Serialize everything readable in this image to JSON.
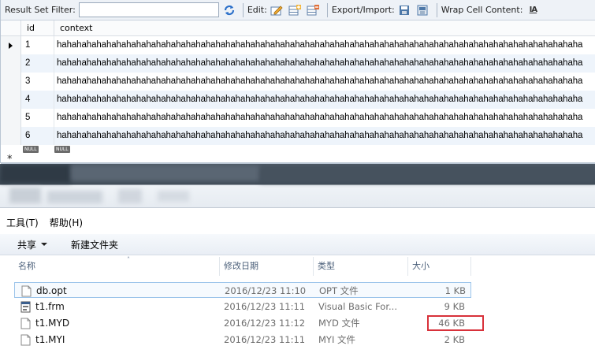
{
  "workbench": {
    "toolbar": {
      "filter_label": "Result Set Filter:",
      "filter_value": "",
      "edit_label": "Edit:",
      "export_label": "Export/Import:",
      "wrap_label": "Wrap Cell Content:",
      "wrap_icon_glyph": "IA",
      "icons": [
        "refresh-icon",
        "edit-row-icon",
        "add-row-icon",
        "delete-row-icon",
        "export-icon",
        "import-icon",
        "wrap-cell-icon"
      ]
    },
    "grid": {
      "columns": [
        "id",
        "context"
      ],
      "rows": [
        {
          "id": "1",
          "context": "hahahahahahahahahahahahahahahahahahahahahahahahahahahahahahahahahahahahahahahahahahahahahahahahahahahahaha"
        },
        {
          "id": "2",
          "context": "hahahahahahahahahahahahahahahahahahahahahahahahahahahahahahahahahahahahahahahahahahahahahahahahahahahahaha"
        },
        {
          "id": "3",
          "context": "hahahahahahahahahahahahahahahahahahahahahahahahahahahahahahahahahahahahahahahahahahahahahahahahahahahahaha"
        },
        {
          "id": "4",
          "context": "hahahahahahahahahahahahahahahahahahahahahahahahahahahahahahahahahahahahahahahahahahahahahahahahahahahahaha"
        },
        {
          "id": "5",
          "context": "hahahahahahahahahahahahahahahahahahahahahahahahahahahahahahahahahahahahahahahahahahahahahahahahahahahahaha"
        },
        {
          "id": "6",
          "context": "hahahahahahahahahahahahahahahahahahahahahahahahahahahahahahahahahahahahahahahahahahahahahahahahahahahahaha"
        }
      ],
      "null_label": "NULL",
      "new_row_marker": "*"
    }
  },
  "explorer": {
    "menu": [
      "工具(T)",
      "帮助(H)"
    ],
    "commands": {
      "share": "共享",
      "new_folder": "新建文件夹"
    },
    "columns": {
      "name": "名称",
      "modified": "修改日期",
      "type": "类型",
      "size": "大小"
    },
    "files": [
      {
        "name": "db.opt",
        "modified": "2016/12/23 11:10",
        "type": "OPT 文件",
        "size": "1 KB",
        "icon": "document-icon",
        "selected": true
      },
      {
        "name": "t1.frm",
        "modified": "2016/12/23 11:11",
        "type": "Visual Basic For...",
        "size": "9 KB",
        "icon": "vb-form-icon",
        "selected": false
      },
      {
        "name": "t1.MYD",
        "modified": "2016/12/23 11:12",
        "type": "MYD 文件",
        "size": "46 KB",
        "icon": "document-icon",
        "selected": false,
        "highlighted": true
      },
      {
        "name": "t1.MYI",
        "modified": "2016/12/23 11:11",
        "type": "MYI 文件",
        "size": "2 KB",
        "icon": "document-icon",
        "selected": false
      }
    ],
    "highlight_color": "#d8313a"
  }
}
